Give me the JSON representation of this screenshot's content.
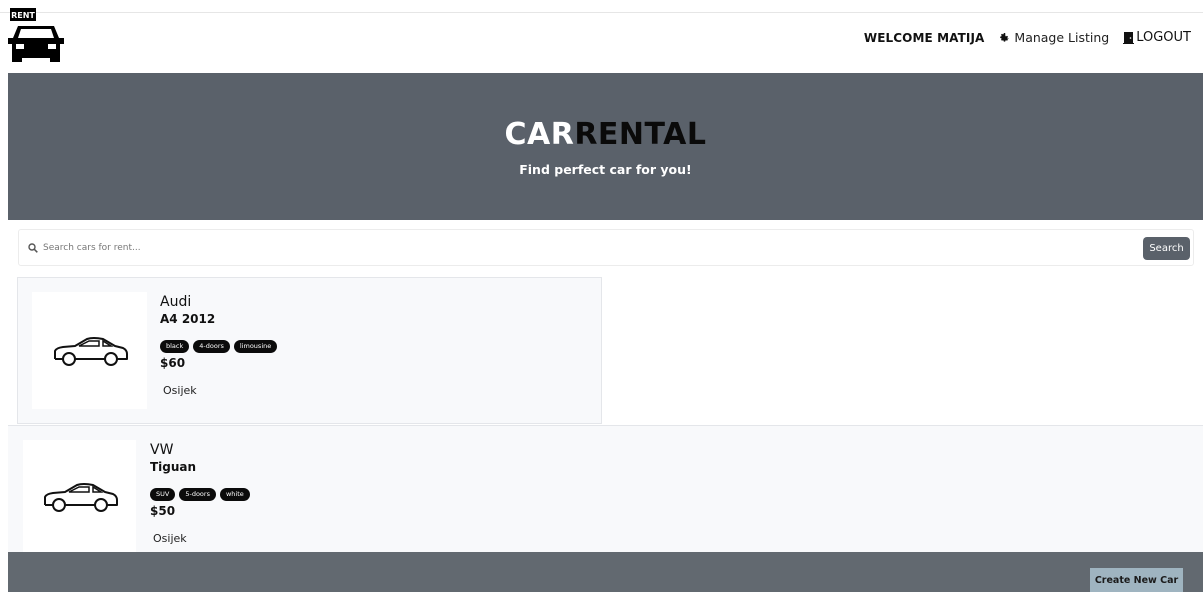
{
  "logo": {
    "text": "RENT"
  },
  "nav": {
    "welcome": "WELCOME MATIJA",
    "manage_listing": "Manage Listing",
    "logout": "LOGOUT"
  },
  "hero": {
    "title_part1": "CAR",
    "title_part2": "RENTAL",
    "subtitle": "Find perfect car for you!"
  },
  "search": {
    "placeholder": "Search cars for rent...",
    "button_label": "Search"
  },
  "cars": [
    {
      "make": "Audi",
      "model": "A4 2012",
      "tags": [
        "black",
        "4-doors",
        "limousine"
      ],
      "price": "$60",
      "location": "Osijek"
    },
    {
      "make": "VW",
      "model": "Tiguan",
      "tags": [
        "SUV",
        "5-doors",
        "white"
      ],
      "price": "$50",
      "location": "Osijek"
    }
  ],
  "footer": {
    "create_button": "Create New Car"
  },
  "colors": {
    "hero_bg": "#5a616a",
    "footer_bg": "#626970",
    "accent_button": "#9fb4c0",
    "tag_bg": "#0b0b0b"
  }
}
